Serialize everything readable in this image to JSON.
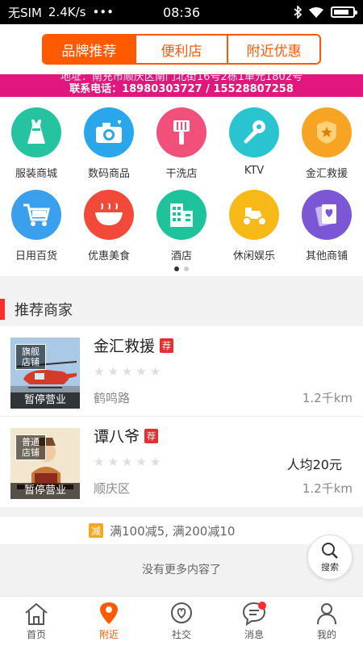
{
  "status_bar": {
    "carrier": "无SIM",
    "speed": "2.4K/s",
    "dots": "•••",
    "time": "08:36"
  },
  "header": {
    "tabs": [
      {
        "label": "品牌推荐"
      },
      {
        "label": "便利店"
      },
      {
        "label": "附近优惠"
      }
    ]
  },
  "banner": {
    "line1": "地址：南充市顺庆区南门北街16号2栋1单元1802号",
    "line2": "联系电话：18980303727 / 15528807258"
  },
  "categories": [
    {
      "label": "服装商城",
      "icon": "dress-icon",
      "color": "#26c3a0"
    },
    {
      "label": "数码商品",
      "icon": "camera-icon",
      "color": "#2aa6ea"
    },
    {
      "label": "干洗店",
      "icon": "brush-icon",
      "color": "#f0507a"
    },
    {
      "label": "KTV",
      "icon": "microphone-icon",
      "color": "#2ac4d0"
    },
    {
      "label": "金汇救援",
      "icon": "badge-icon",
      "color": "#f7a425"
    },
    {
      "label": "日用百货",
      "icon": "cart-icon",
      "color": "#3aa0ee"
    },
    {
      "label": "优惠美食",
      "icon": "bowl-icon",
      "color": "#f24a3a"
    },
    {
      "label": "酒店",
      "icon": "building-icon",
      "color": "#1fc39b"
    },
    {
      "label": "休闲娱乐",
      "icon": "scooter-icon",
      "color": "#f7b918"
    },
    {
      "label": "其他商铺",
      "icon": "card-icon",
      "color": "#7b57d6"
    }
  ],
  "section": {
    "title": "推荐商家"
  },
  "shops": [
    {
      "name": "金汇救援",
      "rec": "荐",
      "tag": "旗舰店铺",
      "status": "暂停营业",
      "location": "鹤鸣路",
      "distance": "1.2千km",
      "price": ""
    },
    {
      "name": "谭八爷",
      "rec": "荐",
      "tag": "普通店铺",
      "status": "暂停营业",
      "location": "顺庆区",
      "distance": "1.2千km",
      "price": "人均20元"
    }
  ],
  "promo": {
    "badge": "减",
    "text": "满100减5, 满200减10"
  },
  "footer_text": "没有更多内容了",
  "search_fab": {
    "label": "搜索"
  },
  "tabbar": [
    {
      "label": "首页",
      "icon": "home-icon"
    },
    {
      "label": "附近",
      "icon": "location-icon",
      "active": true
    },
    {
      "label": "社交",
      "icon": "heart-chat-icon"
    },
    {
      "label": "消息",
      "icon": "message-icon",
      "badge": true
    },
    {
      "label": "我的",
      "icon": "user-icon"
    }
  ]
}
